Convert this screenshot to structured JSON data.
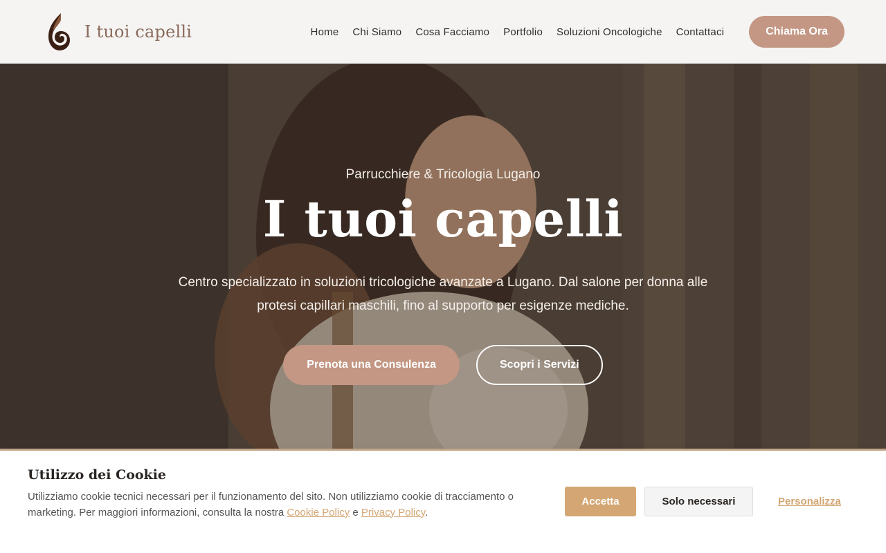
{
  "header": {
    "logo_icon": "flame-swirl-icon",
    "brand": "I tuoi capelli",
    "nav": [
      "Home",
      "Chi Siamo",
      "Cosa Facciamo",
      "Portfolio",
      "Soluzioni Oncologiche",
      "Contattaci"
    ],
    "cta_label": "Chiama Ora"
  },
  "hero": {
    "eyebrow": "Parrucchiere & Tricologia Lugano",
    "title": "I tuoi capelli",
    "description": "Centro specializzato in soluzioni tricologiche avanzate a Lugano. Dal salone per donna alle protesi capillari maschili, fino al supporto per esigenze mediche.",
    "primary_button": "Prenota una Consulenza",
    "secondary_button": "Scopri i Servizi"
  },
  "cookie_banner": {
    "title": "Utilizzo dei Cookie",
    "text_before": "Utilizziamo cookie tecnici necessari per il funzionamento del sito. Non utilizziamo cookie di tracciamento o marketing. Per maggiori informazioni, consulta la nostra ",
    "link_cookie_policy": "Cookie Policy",
    "text_and": " e ",
    "link_privacy_policy": "Privacy Policy",
    "text_end": ".",
    "accept_label": "Accetta",
    "necessary_label": "Solo necessari",
    "customize_label": "Personalizza"
  },
  "colors": {
    "accent": "#c39784",
    "cookie_accent": "#d3a673",
    "brand_text": "#8a6a5c"
  }
}
